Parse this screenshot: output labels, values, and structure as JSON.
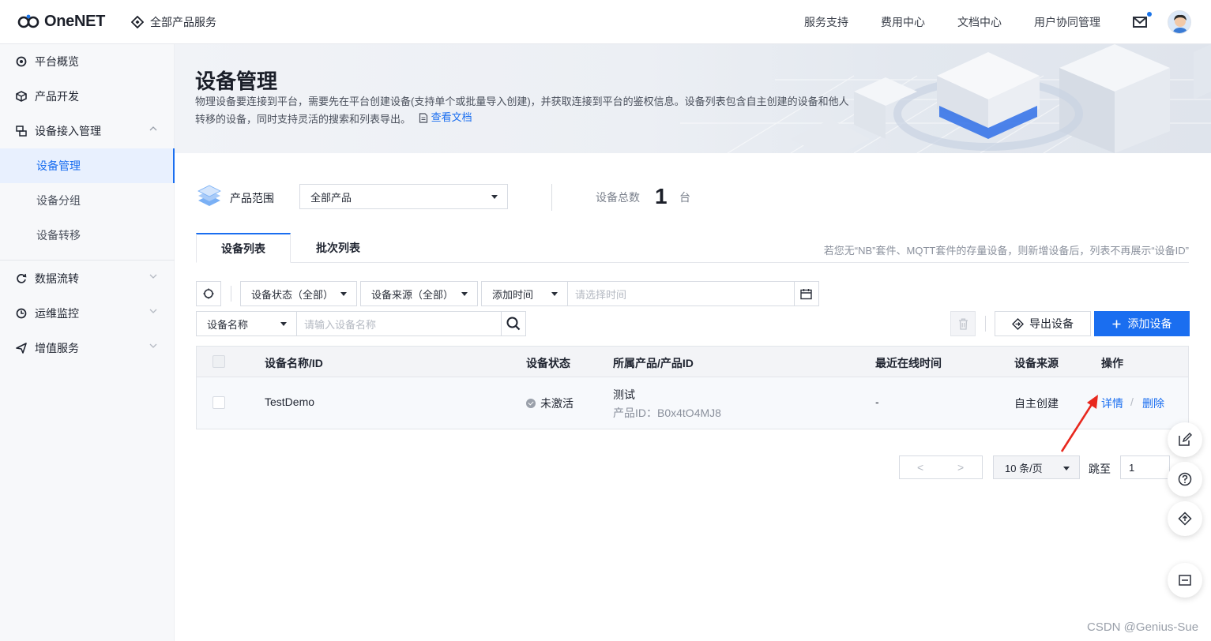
{
  "header": {
    "logo_text": "OneNET",
    "all_products": "全部产品服务",
    "nav": [
      "服务支持",
      "费用中心",
      "文档中心",
      "用户协同管理"
    ]
  },
  "sidebar": {
    "items": [
      {
        "label": "平台概览"
      },
      {
        "label": "产品开发"
      },
      {
        "label": "设备接入管理"
      },
      {
        "label": "数据流转"
      },
      {
        "label": "运维监控"
      },
      {
        "label": "增值服务"
      }
    ],
    "sub_items": [
      {
        "label": "设备管理",
        "active": true
      },
      {
        "label": "设备分组",
        "active": false
      },
      {
        "label": "设备转移",
        "active": false
      }
    ]
  },
  "banner": {
    "title": "设备管理",
    "desc_line1": "物理设备要连接到平台，需要先在平台创建设备(支持单个或批量导入创建)，并获取连接到平台的鉴权信息。设备列表包含自主创建的设备和他人",
    "desc_line2": "转移的设备，同时支持灵活的搜索和列表导出。",
    "doc_link": "查看文档"
  },
  "scope": {
    "label": "产品范围",
    "selected": "全部产品",
    "total_label": "设备总数",
    "total_value": "1",
    "total_unit": "台"
  },
  "tabs": {
    "items": [
      "设备列表",
      "批次列表"
    ],
    "note": "若您无“NB”套件、MQTT套件的存量设备，则新增设备后，列表不再展示“设备ID”"
  },
  "filters": {
    "status": "设备状态（全部）",
    "source": "设备来源（全部）",
    "time_field": "添加时间",
    "time_placeholder": "请选择时间",
    "search_field": "设备名称",
    "search_placeholder": "请输入设备名称",
    "export_label": "导出设备",
    "add_label": "添加设备"
  },
  "table": {
    "headers": [
      "设备名称/ID",
      "设备状态",
      "所属产品/产品ID",
      "最近在线时间",
      "设备来源",
      "操作"
    ],
    "rows": [
      {
        "name": "TestDemo",
        "status": "未激活",
        "product": "测试",
        "product_id": "产品ID：B0x4tO4MJ8",
        "last_online": "-",
        "source": "自主创建",
        "action_detail": "详情",
        "action_sep": "/",
        "action_delete": "删除"
      }
    ]
  },
  "pagination": {
    "prev": "<",
    "next": ">",
    "per_page": "10 条/页",
    "jump_label": "跳至",
    "jump_value": "1"
  },
  "watermark": "CSDN @Genius-Sue",
  "colors": {
    "accent": "#1a6ef0",
    "arrow": "#e8281e"
  },
  "icons": [
    "search-icon",
    "calendar-icon",
    "refresh-icon",
    "trash-icon",
    "export-icon",
    "plus-icon",
    "mail-icon",
    "doc-icon",
    "edit-icon",
    "help-icon",
    "upload-icon",
    "minus-icon"
  ]
}
